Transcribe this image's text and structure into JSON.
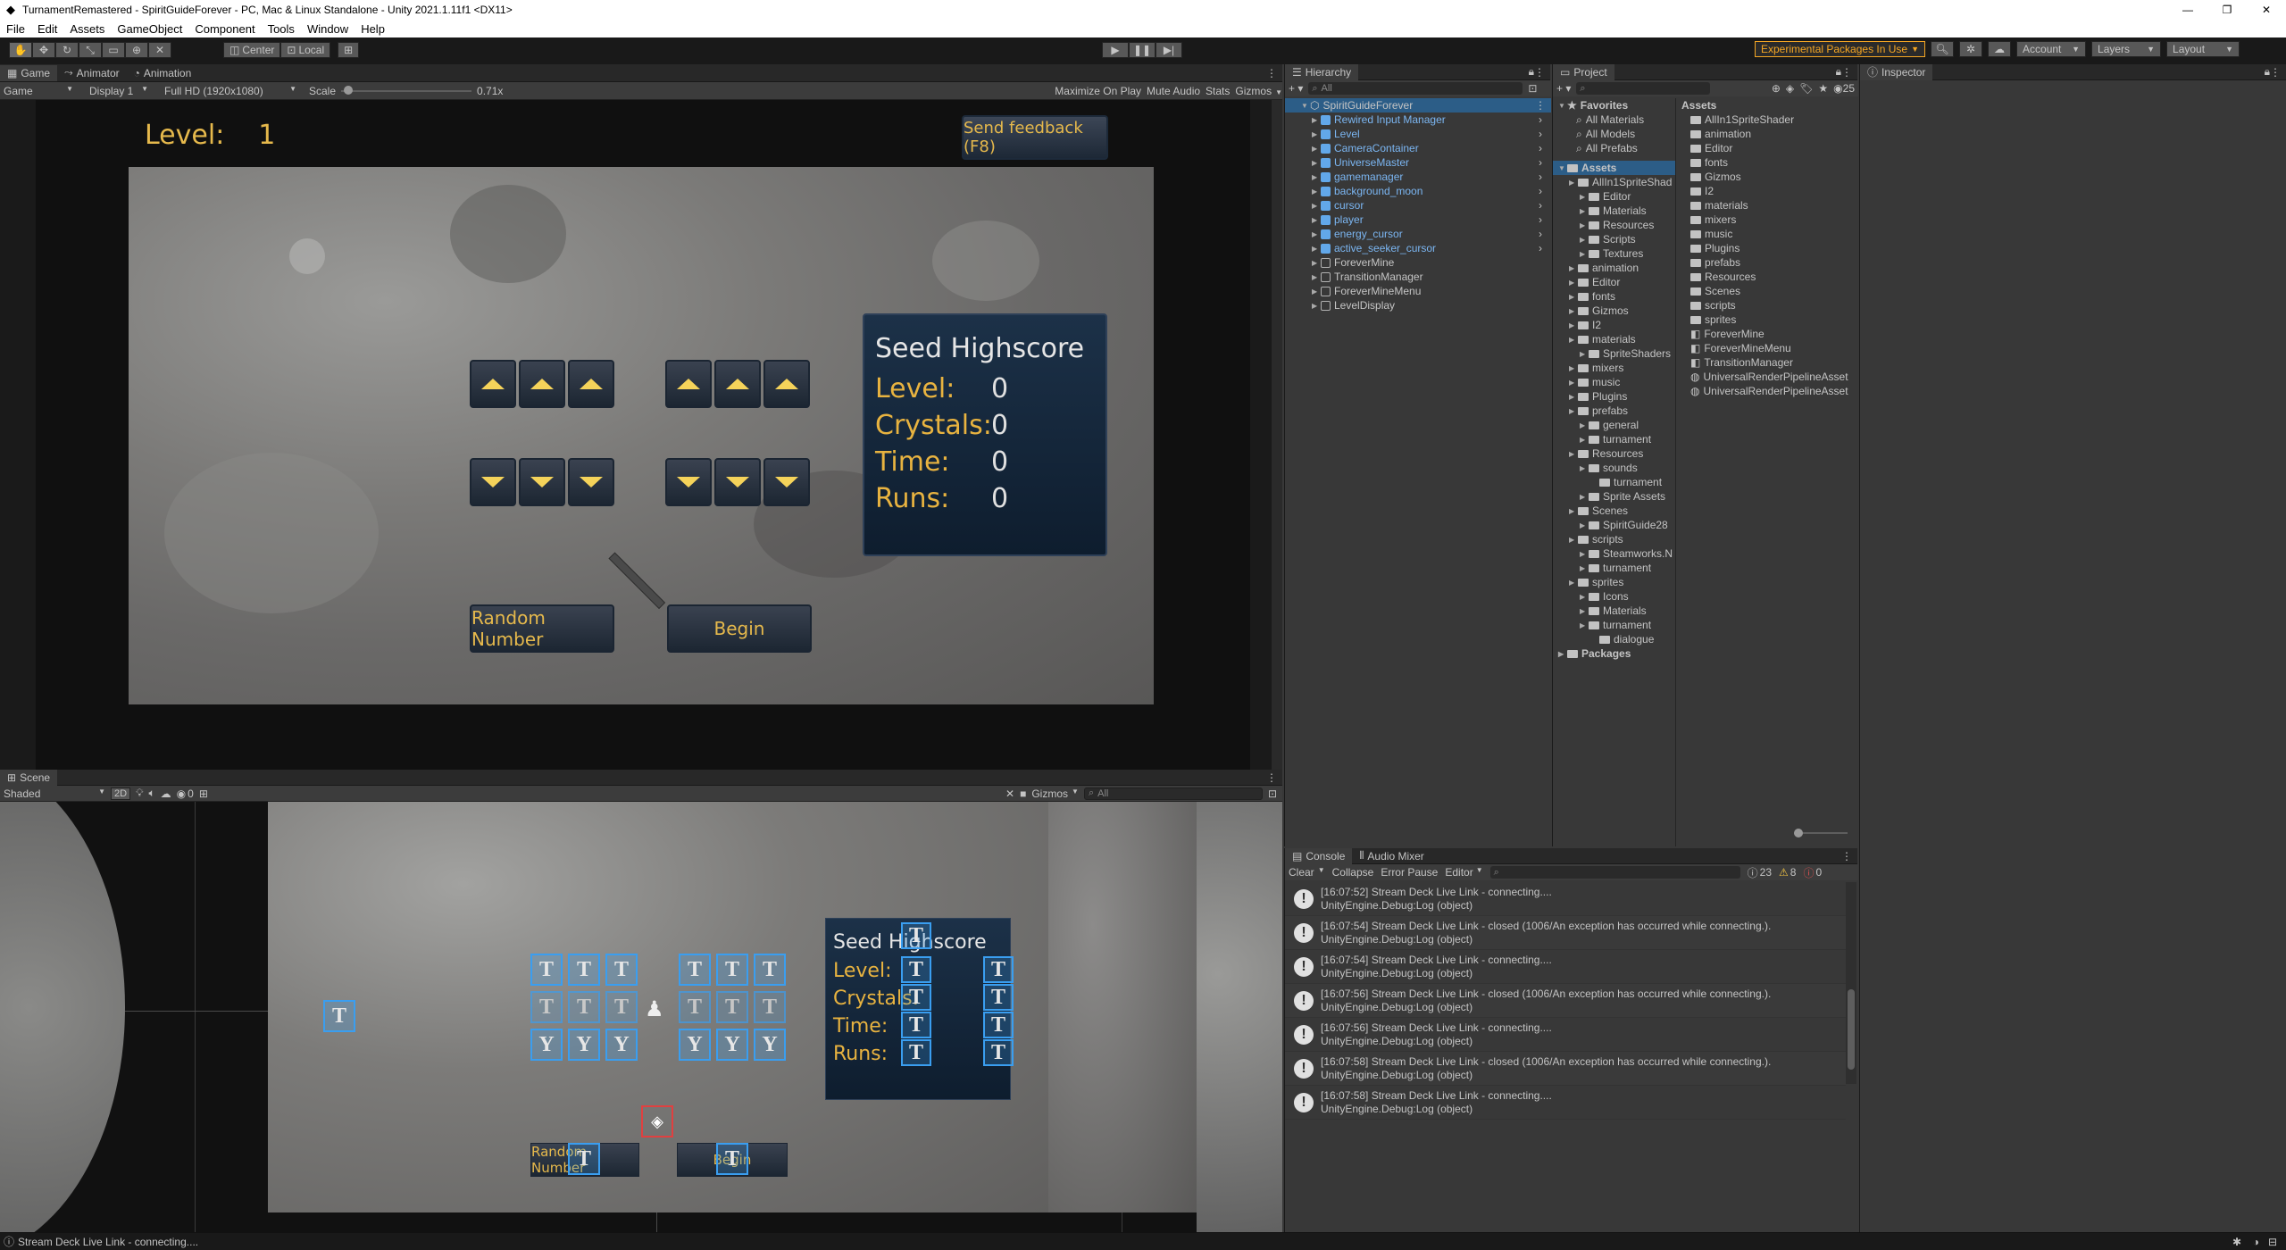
{
  "window": {
    "title": "TurnamentRemastered - SpiritGuideForever - PC, Mac & Linux Standalone - Unity 2021.1.11f1 <DX11>"
  },
  "menu": [
    "File",
    "Edit",
    "Assets",
    "GameObject",
    "Component",
    "Tools",
    "Window",
    "Help"
  ],
  "toolbar": {
    "center_label": "Center",
    "local_label": "Local",
    "experimental_label": "Experimental Packages In Use",
    "account_label": "Account",
    "layers_label": "Layers",
    "layout_label": "Layout"
  },
  "game_panel": {
    "tabs": [
      "Game",
      "Animator",
      "Animation"
    ],
    "game_dropdown": "Game",
    "display_dropdown": "Display 1",
    "resolution_dropdown": "Full HD (1920x1080)",
    "scale_label": "Scale",
    "scale_value": "0.71x",
    "scale_fraction": 0.02,
    "maximize_label": "Maximize On Play",
    "mute_label": "Mute Audio",
    "stats_label": "Stats",
    "gizmos_label": "Gizmos",
    "level_label": "Level:",
    "level_value": "1",
    "feedback_label": "Send feedback (F8)",
    "random_label": "Random Number",
    "begin_label": "Begin",
    "highscore": {
      "title": "Seed Highscore",
      "rows": [
        {
          "label": "Level:",
          "value": "0"
        },
        {
          "label": "Crystals:",
          "value": "0"
        },
        {
          "label": "Time:",
          "value": "0"
        },
        {
          "label": "Runs:",
          "value": "0"
        }
      ]
    }
  },
  "scene_panel": {
    "tab": "Scene",
    "shading": "Shaded",
    "mode_2d": "2D",
    "gizmos_label": "Gizmos",
    "search_placeholder": "All",
    "hidden_count": "0",
    "highscore": {
      "title": "Seed Highscore",
      "labels": [
        "Level:",
        "Crystals:",
        "Time:",
        "Runs:"
      ]
    },
    "random_label": "Random Number",
    "begin_label": "Begin"
  },
  "hierarchy": {
    "tab": "Hierarchy",
    "search_placeholder": "All",
    "root": "SpiritGuideForever",
    "items": [
      {
        "label": "Rewired Input Manager",
        "prefab": true
      },
      {
        "label": "Level",
        "prefab": true
      },
      {
        "label": "CameraContainer",
        "prefab": true
      },
      {
        "label": "UniverseMaster",
        "prefab": true
      },
      {
        "label": "gamemanager",
        "prefab": true
      },
      {
        "label": "background_moon",
        "prefab": true
      },
      {
        "label": "cursor",
        "prefab": true
      },
      {
        "label": "player",
        "prefab": true
      },
      {
        "label": "energy_cursor",
        "prefab": true
      },
      {
        "label": "active_seeker_cursor",
        "prefab": true
      },
      {
        "label": "ForeverMine",
        "prefab": false
      },
      {
        "label": "TransitionManager",
        "prefab": false
      },
      {
        "label": "ForeverMineMenu",
        "prefab": false
      },
      {
        "label": "LevelDisplay",
        "prefab": false
      }
    ]
  },
  "project": {
    "tab": "Project",
    "count": "25",
    "favorites_label": "Favorites",
    "favorites": [
      "All Materials",
      "All Models",
      "All Prefabs"
    ],
    "assets_label": "Assets",
    "tree": [
      {
        "label": "AllIn1SpriteShad",
        "depth": 1
      },
      {
        "label": "Editor",
        "depth": 2
      },
      {
        "label": "Materials",
        "depth": 2
      },
      {
        "label": "Resources",
        "depth": 2
      },
      {
        "label": "Scripts",
        "depth": 2
      },
      {
        "label": "Textures",
        "depth": 2
      },
      {
        "label": "animation",
        "depth": 1
      },
      {
        "label": "Editor",
        "depth": 1
      },
      {
        "label": "fonts",
        "depth": 1
      },
      {
        "label": "Gizmos",
        "depth": 1
      },
      {
        "label": "I2",
        "depth": 1
      },
      {
        "label": "materials",
        "depth": 1
      },
      {
        "label": "SpriteShaders",
        "depth": 2
      },
      {
        "label": "mixers",
        "depth": 1
      },
      {
        "label": "music",
        "depth": 1
      },
      {
        "label": "Plugins",
        "depth": 1
      },
      {
        "label": "prefabs",
        "depth": 1
      },
      {
        "label": "general",
        "depth": 2
      },
      {
        "label": "turnament",
        "depth": 2
      },
      {
        "label": "Resources",
        "depth": 1
      },
      {
        "label": "sounds",
        "depth": 2
      },
      {
        "label": "turnament",
        "depth": 3
      },
      {
        "label": "Sprite Assets",
        "depth": 2
      },
      {
        "label": "Scenes",
        "depth": 1
      },
      {
        "label": "SpiritGuide28",
        "depth": 2
      },
      {
        "label": "scripts",
        "depth": 1
      },
      {
        "label": "Steamworks.N",
        "depth": 2
      },
      {
        "label": "turnament",
        "depth": 2
      },
      {
        "label": "sprites",
        "depth": 1
      },
      {
        "label": "Icons",
        "depth": 2
      },
      {
        "label": "Materials",
        "depth": 2
      },
      {
        "label": "turnament",
        "depth": 2
      },
      {
        "label": "dialogue",
        "depth": 3
      }
    ],
    "packages_label": "Packages",
    "assets_header": "Assets",
    "assets_list": [
      {
        "label": "AllIn1SpriteShader",
        "type": "folder"
      },
      {
        "label": "animation",
        "type": "folder"
      },
      {
        "label": "Editor",
        "type": "folder"
      },
      {
        "label": "fonts",
        "type": "folder"
      },
      {
        "label": "Gizmos",
        "type": "folder"
      },
      {
        "label": "I2",
        "type": "folder"
      },
      {
        "label": "materials",
        "type": "folder"
      },
      {
        "label": "mixers",
        "type": "folder"
      },
      {
        "label": "music",
        "type": "folder"
      },
      {
        "label": "Plugins",
        "type": "folder"
      },
      {
        "label": "prefabs",
        "type": "folder"
      },
      {
        "label": "Resources",
        "type": "folder"
      },
      {
        "label": "Scenes",
        "type": "folder"
      },
      {
        "label": "scripts",
        "type": "folder"
      },
      {
        "label": "sprites",
        "type": "folder"
      },
      {
        "label": "ForeverMine",
        "type": "scene"
      },
      {
        "label": "ForeverMineMenu",
        "type": "scene"
      },
      {
        "label": "TransitionManager",
        "type": "scene"
      },
      {
        "label": "UniversalRenderPipelineAsset",
        "type": "asset"
      },
      {
        "label": "UniversalRenderPipelineAsset",
        "type": "asset"
      }
    ]
  },
  "inspector": {
    "tab": "Inspector"
  },
  "console": {
    "tabs": [
      "Console",
      "Audio Mixer"
    ],
    "clear_label": "Clear",
    "collapse_label": "Collapse",
    "error_pause_label": "Error Pause",
    "editor_label": "Editor",
    "log_count": "23",
    "warn_count": "8",
    "error_count": "0",
    "entries": [
      {
        "line1": "[16:07:52] Stream Deck Live Link - connecting....",
        "line2": "UnityEngine.Debug:Log (object)"
      },
      {
        "line1": "[16:07:54] Stream Deck Live Link - closed (1006/An exception has occurred while connecting.).",
        "line2": "UnityEngine.Debug:Log (object)"
      },
      {
        "line1": "[16:07:54] Stream Deck Live Link - connecting....",
        "line2": "UnityEngine.Debug:Log (object)"
      },
      {
        "line1": "[16:07:56] Stream Deck Live Link - closed (1006/An exception has occurred while connecting.).",
        "line2": "UnityEngine.Debug:Log (object)"
      },
      {
        "line1": "[16:07:56] Stream Deck Live Link - connecting....",
        "line2": "UnityEngine.Debug:Log (object)"
      },
      {
        "line1": "[16:07:58] Stream Deck Live Link - closed (1006/An exception has occurred while connecting.).",
        "line2": "UnityEngine.Debug:Log (object)"
      },
      {
        "line1": "[16:07:58] Stream Deck Live Link - connecting....",
        "line2": "UnityEngine.Debug:Log (object)"
      }
    ]
  },
  "status_bar": {
    "message": "Stream Deck Live Link - connecting...."
  },
  "colors": {
    "accent_blue": "#3a9ef0",
    "gold": "#e8b340",
    "experimental": "#f5a623"
  }
}
